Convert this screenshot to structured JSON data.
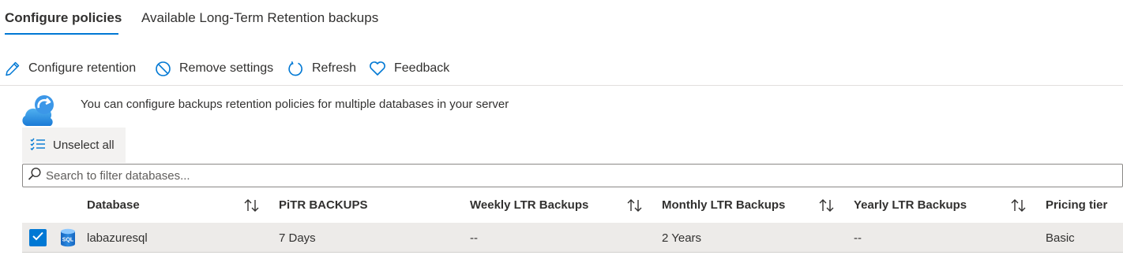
{
  "tabs": [
    {
      "label": "Configure policies",
      "active": true
    },
    {
      "label": "Available Long-Term Retention backups",
      "active": false
    }
  ],
  "toolbar": {
    "configure": "Configure retention",
    "remove": "Remove settings",
    "refresh": "Refresh",
    "feedback": "Feedback"
  },
  "info": {
    "text": "You can configure backups retention policies for multiple databases in your server"
  },
  "unselect_label": "Unselect all",
  "search": {
    "placeholder": "Search to filter databases..."
  },
  "table": {
    "headers": [
      "Database",
      "PiTR BACKUPS",
      "Weekly LTR Backups",
      "Monthly LTR Backups",
      "Yearly LTR Backups",
      "Pricing tier"
    ],
    "rows": [
      {
        "checked": true,
        "icon": "sql-database-icon",
        "icon_text": "SQL",
        "database": "labazuresql",
        "pitr": "7 Days",
        "weekly": "--",
        "monthly": "2 Years",
        "yearly": "--",
        "tier": "Basic"
      }
    ]
  },
  "colors": {
    "accent": "#0078d4",
    "row_selected": "#edebe9",
    "command_bg": "#f3f2f1"
  }
}
